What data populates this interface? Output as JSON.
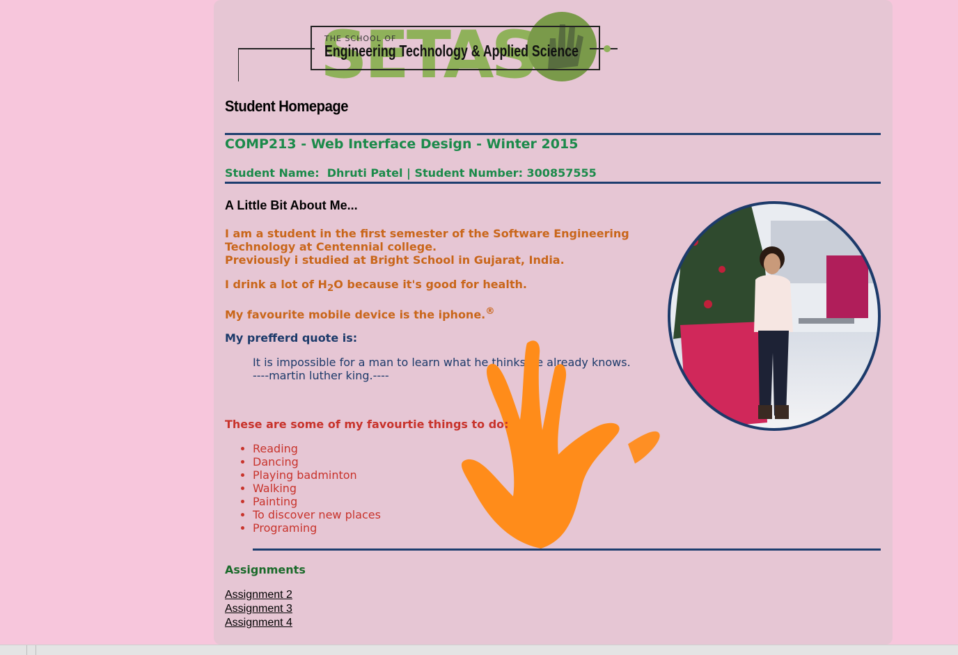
{
  "logo": {
    "brand_text": "SETAS",
    "subtitle_small": "THE SCHOOL OF",
    "subtitle_main": "Engineering Technology & Applied Science"
  },
  "page_heading": "Student Homepage",
  "course_title": "COMP213 - Web Interface Design - Winter 2015",
  "student_line": "Student Name:  Dhruti Patel | Student Number: 300857555",
  "about": {
    "title": "A Little Bit About Me...",
    "line1": "I am a student in the first semester of the Software Engineering",
    "line2": "Technology at Centennial college.",
    "line3": "Previously i studied at Bright School in Gujarat, India.",
    "drink_prefix": "I drink a lot of H",
    "drink_sub": "2",
    "drink_suffix": "O because it's good for health.",
    "device_text": "My favourite mobile device is the iphone.",
    "device_sup": "®"
  },
  "quote": {
    "title": "My prefferd quote is:",
    "text": "It is impossible for a man to learn what he thinks he already knows.",
    "author": "----martin luther king.----"
  },
  "favourites": {
    "title": "These are some of my favourtie things to do:",
    "items": [
      "Reading",
      "Dancing",
      "Playing badminton",
      "Walking",
      "Painting",
      "To discover new places",
      "Programing"
    ]
  },
  "assignments": {
    "title": "Assignments",
    "links": [
      "Assignment 2",
      "Assignment 3",
      "Assignment 4"
    ]
  },
  "colors": {
    "page_bg": "#f7c6dc",
    "content_bg": "#e6c6d4",
    "rule": "#1c3d6e",
    "green": "#1b8a4a",
    "orange": "#c9661a",
    "navy": "#1c3a6a",
    "red": "#c8332b",
    "hand": "#ff8c1a"
  }
}
